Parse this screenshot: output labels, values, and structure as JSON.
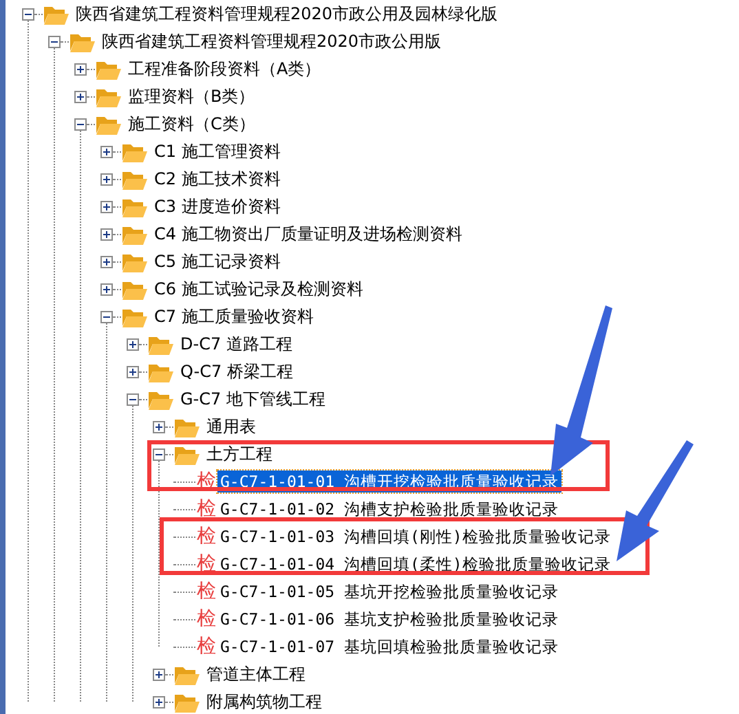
{
  "tree": [
    {
      "label": "陕西省建筑工程资料管理规程2020市政公用及园林绿化版",
      "kind": "folder",
      "expanded": true,
      "children": [
        {
          "label": "陕西省建筑工程资料管理规程2020市政公用版",
          "kind": "folder",
          "expanded": true,
          "children": [
            {
              "label": "工程准备阶段资料（A类）",
              "kind": "folder",
              "expanded": false
            },
            {
              "label": "监理资料（B类）",
              "kind": "folder",
              "expanded": false
            },
            {
              "label": "施工资料（C类）",
              "kind": "folder",
              "expanded": true,
              "children": [
                {
                  "label": "C1 施工管理资料",
                  "kind": "folder",
                  "expanded": false
                },
                {
                  "label": "C2 施工技术资料",
                  "kind": "folder",
                  "expanded": false
                },
                {
                  "label": "C3 进度造价资料",
                  "kind": "folder",
                  "expanded": false
                },
                {
                  "label": "C4 施工物资出厂质量证明及进场检测资料",
                  "kind": "folder",
                  "expanded": false
                },
                {
                  "label": "C5 施工记录资料",
                  "kind": "folder",
                  "expanded": false
                },
                {
                  "label": "C6 施工试验记录及检测资料",
                  "kind": "folder",
                  "expanded": false
                },
                {
                  "label": "C7 施工质量验收资料",
                  "kind": "folder",
                  "expanded": true,
                  "children": [
                    {
                      "label": "D-C7 道路工程",
                      "kind": "folder",
                      "expanded": false
                    },
                    {
                      "label": "Q-C7 桥梁工程",
                      "kind": "folder",
                      "expanded": false
                    },
                    {
                      "label": "G-C7 地下管线工程",
                      "kind": "folder",
                      "expanded": true,
                      "children": [
                        {
                          "label": "通用表",
                          "kind": "folder",
                          "expanded": false
                        },
                        {
                          "label": "土方工程",
                          "kind": "folder",
                          "expanded": true,
                          "children": [
                            {
                              "label": "G-C7-1-01-01 沟槽开挖检验批质量验收记录",
                              "kind": "form",
                              "badge": "检",
                              "selected": true
                            },
                            {
                              "label": "G-C7-1-01-02 沟槽支护检验批质量验收记录",
                              "kind": "form",
                              "badge": "检",
                              "selected": false
                            },
                            {
                              "label": "G-C7-1-01-03 沟槽回填(刚性)检验批质量验收记录",
                              "kind": "form",
                              "badge": "检",
                              "selected": false
                            },
                            {
                              "label": "G-C7-1-01-04 沟槽回填(柔性)检验批质量验收记录",
                              "kind": "form",
                              "badge": "检",
                              "selected": false
                            },
                            {
                              "label": "G-C7-1-01-05 基坑开挖检验批质量验收记录",
                              "kind": "form",
                              "badge": "检",
                              "selected": false
                            },
                            {
                              "label": "G-C7-1-01-06 基坑支护检验批质量验收记录",
                              "kind": "form",
                              "badge": "检",
                              "selected": false
                            },
                            {
                              "label": "G-C7-1-01-07 基坑回填检验批质量验收记录",
                              "kind": "form",
                              "badge": "检",
                              "selected": false
                            }
                          ]
                        },
                        {
                          "label": "管道主体工程",
                          "kind": "folder",
                          "expanded": false
                        },
                        {
                          "label": "附属构筑物工程",
                          "kind": "folder",
                          "expanded": false
                        }
                      ]
                    }
                  ]
                }
              ]
            }
          ]
        }
      ]
    }
  ],
  "annotations": [
    {
      "kind": "box"
    },
    {
      "kind": "box"
    },
    {
      "kind": "arrow"
    },
    {
      "kind": "arrow"
    }
  ]
}
